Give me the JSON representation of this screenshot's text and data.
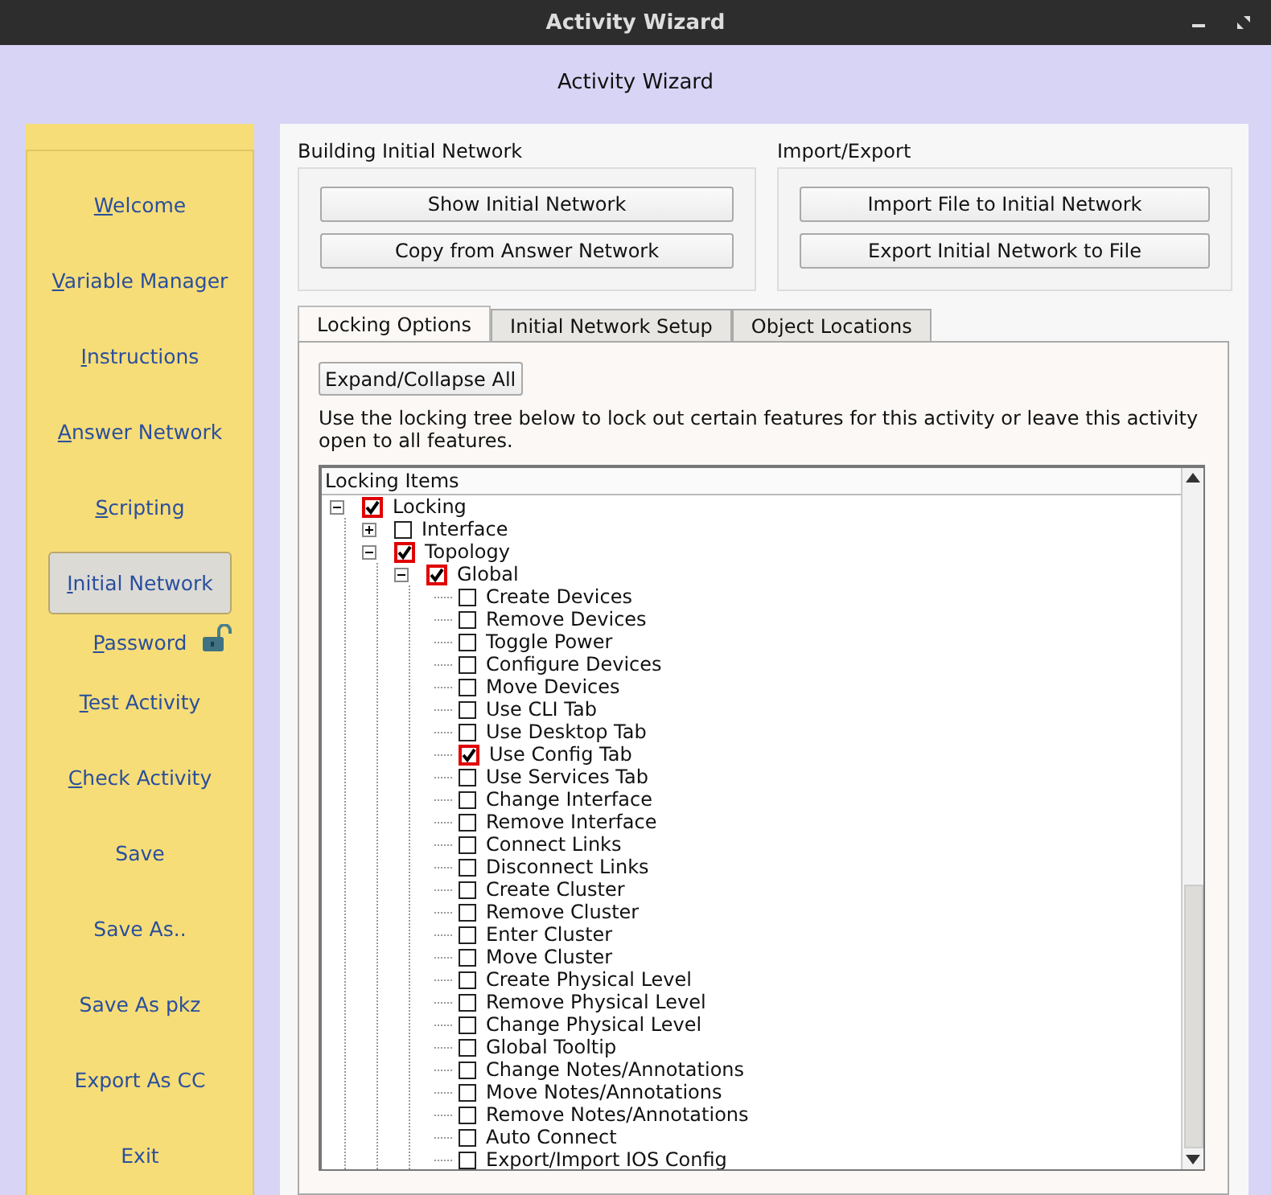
{
  "window": {
    "title": "Activity Wizard"
  },
  "header": "Activity Wizard",
  "sidebar": {
    "items": [
      {
        "label": "Welcome",
        "kind": "link",
        "underline_first": true,
        "selected": false
      },
      {
        "label": "Variable Manager",
        "kind": "link",
        "underline_first": true,
        "selected": false
      },
      {
        "label": "Instructions",
        "kind": "link",
        "underline_first": true,
        "selected": false
      },
      {
        "label": "Answer Network",
        "kind": "link",
        "underline_first": true,
        "selected": false
      },
      {
        "label": "Scripting",
        "kind": "link",
        "underline_first": true,
        "selected": false
      },
      {
        "label": "Initial Network",
        "kind": "link",
        "underline_first": true,
        "selected": true
      },
      {
        "label": "Password",
        "kind": "password",
        "underline_first": true,
        "selected": false
      },
      {
        "label": "Test Activity",
        "kind": "link",
        "underline_first": true,
        "selected": false
      },
      {
        "label": "Check Activity",
        "kind": "link",
        "underline_first": true,
        "selected": false
      },
      {
        "label": "Save",
        "kind": "link",
        "underline_first": false,
        "selected": false
      },
      {
        "label": "Save As..",
        "kind": "link",
        "underline_first": false,
        "selected": false
      },
      {
        "label": "Save As pkz",
        "kind": "link",
        "underline_first": false,
        "selected": false
      },
      {
        "label": "Export As CC",
        "kind": "link",
        "underline_first": false,
        "selected": false
      },
      {
        "label": "Exit",
        "kind": "link",
        "underline_first": false,
        "selected": false
      }
    ]
  },
  "groups": [
    {
      "title": "Building Initial Network",
      "buttons": [
        "Show Initial Network",
        "Copy from Answer Network"
      ]
    },
    {
      "title": "Import/Export",
      "buttons": [
        "Import File to Initial Network",
        "Export Initial Network to File"
      ]
    }
  ],
  "tabs": [
    {
      "label": "Locking Options",
      "selected": true
    },
    {
      "label": "Initial Network Setup",
      "selected": false
    },
    {
      "label": "Object Locations",
      "selected": false
    }
  ],
  "expand_button": "Expand/Collapse All",
  "description": "Use the locking tree below to lock out certain features for this activity or leave this activity open to all features.",
  "tree": {
    "header": "Locking Items",
    "items": [
      {
        "label": "Locking",
        "checked": true,
        "expanded": true,
        "children": [
          {
            "label": "Interface",
            "checked": false,
            "expanded": false
          },
          {
            "label": "Topology",
            "checked": true,
            "expanded": true,
            "children": [
              {
                "label": "Global",
                "checked": true,
                "expanded": true,
                "children": [
                  {
                    "label": "Create Devices",
                    "checked": false
                  },
                  {
                    "label": "Remove Devices",
                    "checked": false
                  },
                  {
                    "label": "Toggle Power",
                    "checked": false
                  },
                  {
                    "label": "Configure Devices",
                    "checked": false
                  },
                  {
                    "label": "Move Devices",
                    "checked": false
                  },
                  {
                    "label": "Use CLI Tab",
                    "checked": false
                  },
                  {
                    "label": "Use Desktop Tab",
                    "checked": false
                  },
                  {
                    "label": "Use Config Tab",
                    "checked": true
                  },
                  {
                    "label": "Use Services Tab",
                    "checked": false
                  },
                  {
                    "label": "Change Interface",
                    "checked": false
                  },
                  {
                    "label": "Remove Interface",
                    "checked": false
                  },
                  {
                    "label": "Connect Links",
                    "checked": false
                  },
                  {
                    "label": "Disconnect Links",
                    "checked": false
                  },
                  {
                    "label": "Create Cluster",
                    "checked": false
                  },
                  {
                    "label": "Remove Cluster",
                    "checked": false
                  },
                  {
                    "label": "Enter Cluster",
                    "checked": false
                  },
                  {
                    "label": "Move Cluster",
                    "checked": false
                  },
                  {
                    "label": "Create Physical Level",
                    "checked": false
                  },
                  {
                    "label": "Remove Physical Level",
                    "checked": false
                  },
                  {
                    "label": "Change Physical Level",
                    "checked": false
                  },
                  {
                    "label": "Global Tooltip",
                    "checked": false
                  },
                  {
                    "label": "Change Notes/Annotations",
                    "checked": false
                  },
                  {
                    "label": "Move Notes/Annotations",
                    "checked": false
                  },
                  {
                    "label": "Remove Notes/Annotations",
                    "checked": false
                  },
                  {
                    "label": "Auto Connect",
                    "checked": false
                  },
                  {
                    "label": "Export/Import IOS Config",
                    "checked": false
                  }
                ]
              }
            ]
          }
        ]
      }
    ]
  }
}
